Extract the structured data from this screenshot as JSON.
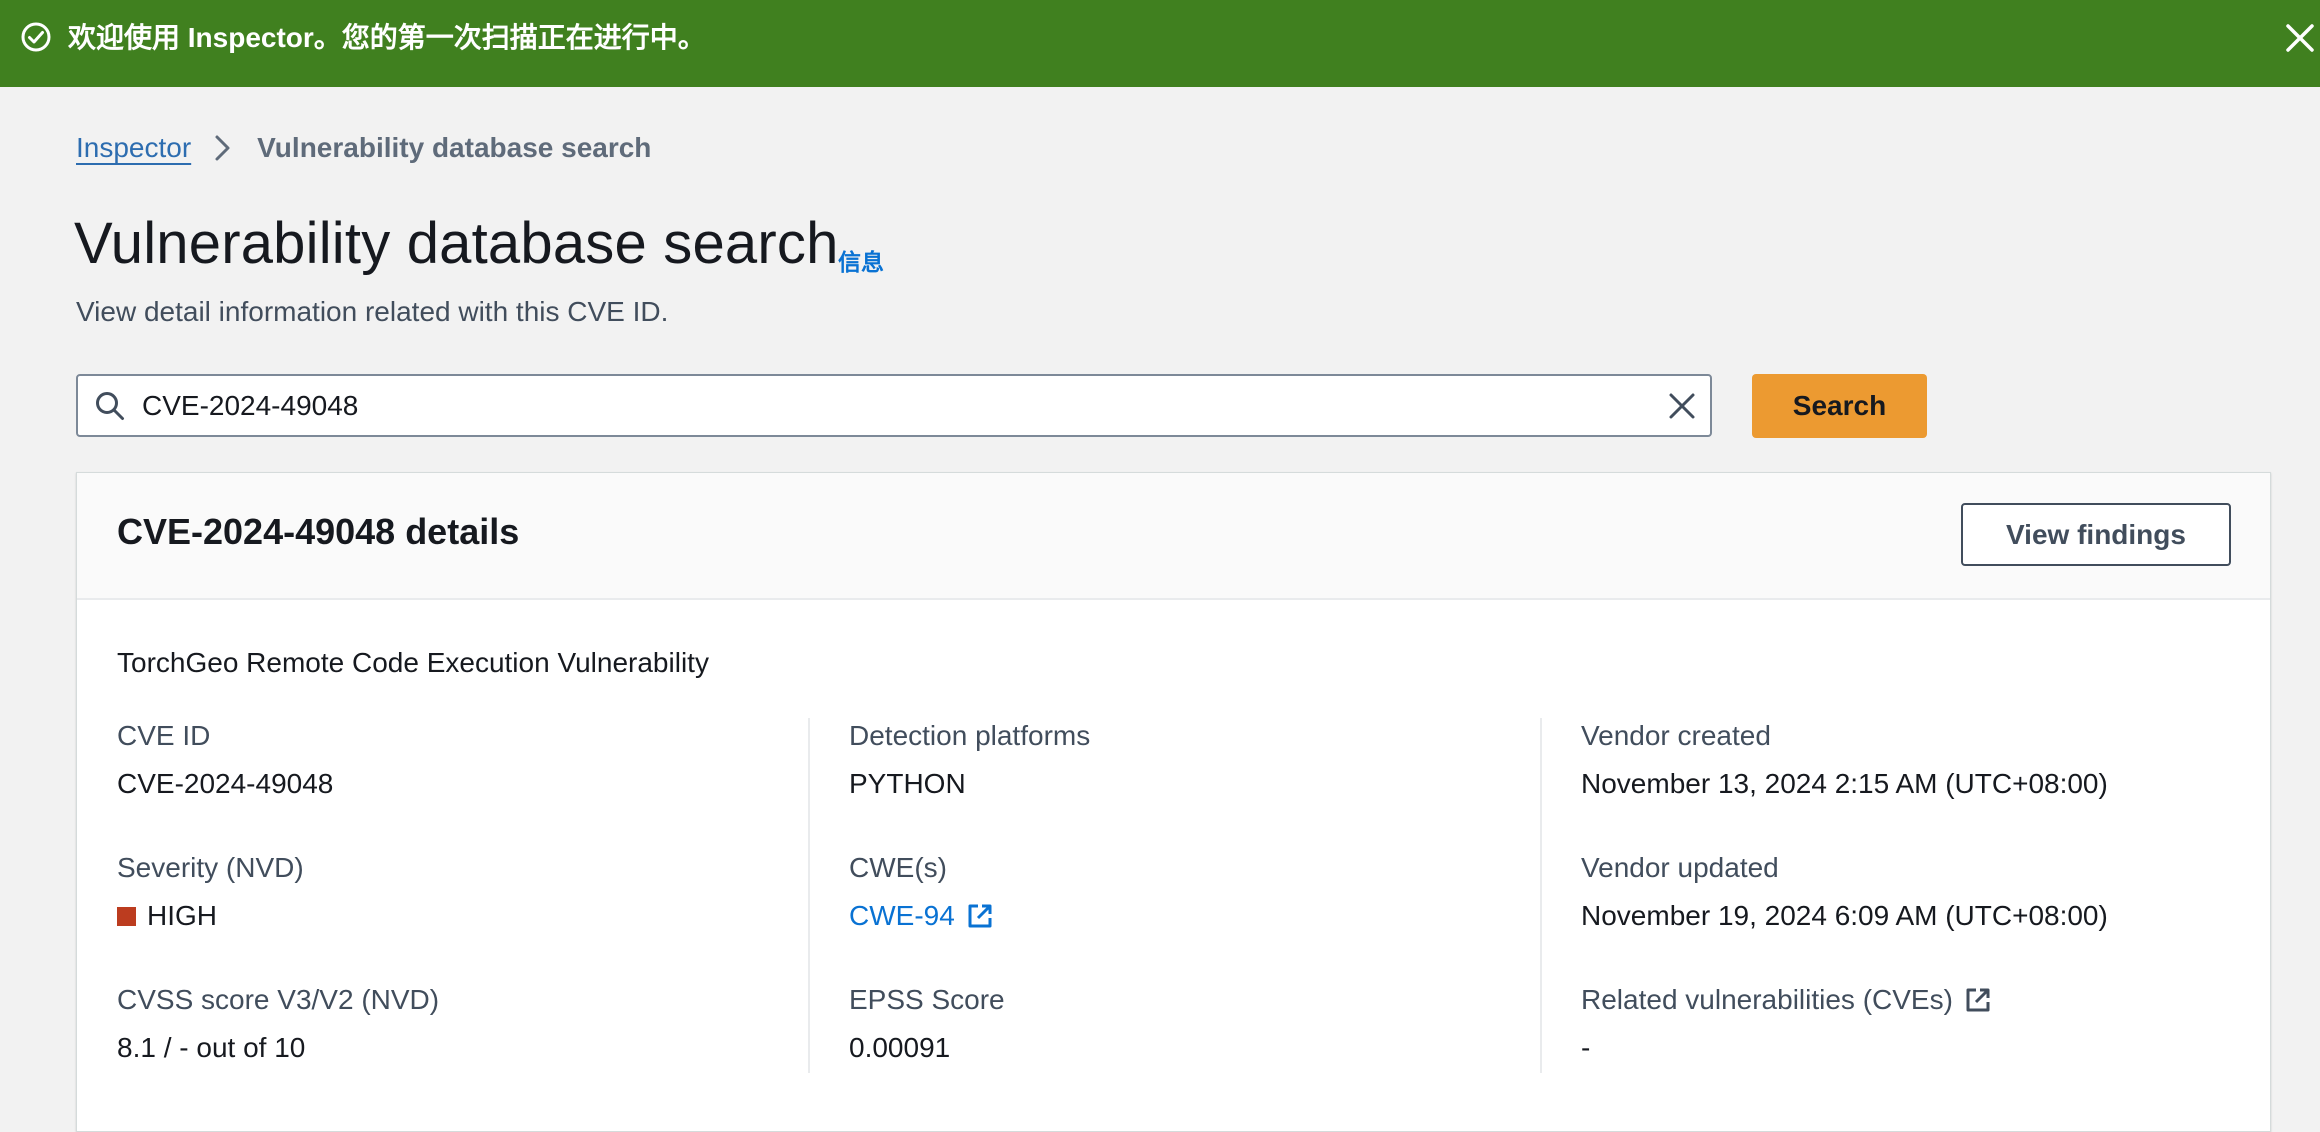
{
  "flash": {
    "message": "欢迎使用 Inspector。您的第一次扫描正在进行中。",
    "icon": "success-check-icon",
    "close_icon": "close-icon",
    "color": "#40801f"
  },
  "breadcrumb": {
    "parent": "Inspector",
    "current": "Vulnerability database search"
  },
  "header": {
    "title": "Vulnerability database search",
    "info_link": "信息",
    "description": "View detail information related with this CVE ID."
  },
  "search": {
    "value": "CVE-2024-49048",
    "button_label": "Search",
    "button_color": "#ec9a31"
  },
  "details": {
    "title": "CVE-2024-49048 details",
    "view_findings_label": "View findings",
    "summary": "TorchGeo Remote Code Execution Vulnerability",
    "columns": [
      [
        {
          "label": "CVE ID",
          "value": "CVE-2024-49048"
        },
        {
          "label": "Severity (NVD)",
          "value": "HIGH",
          "severity_color": "#bc3c1f"
        },
        {
          "label": "CVSS score V3/V2 (NVD)",
          "value": "8.1 / - out of 10"
        }
      ],
      [
        {
          "label": "Detection platforms",
          "value": "PYTHON"
        },
        {
          "label": "CWE(s)",
          "value": "CWE-94"
        },
        {
          "label": "EPSS Score",
          "value": "0.00091"
        }
      ],
      [
        {
          "label": "Vendor created",
          "value": "November 13, 2024 2:15 AM (UTC+08:00)"
        },
        {
          "label": "Vendor updated",
          "value": "November 19, 2024 6:09 AM (UTC+08:00)"
        },
        {
          "label": "Related vulnerabilities (CVEs)",
          "value": "-"
        }
      ]
    ]
  }
}
